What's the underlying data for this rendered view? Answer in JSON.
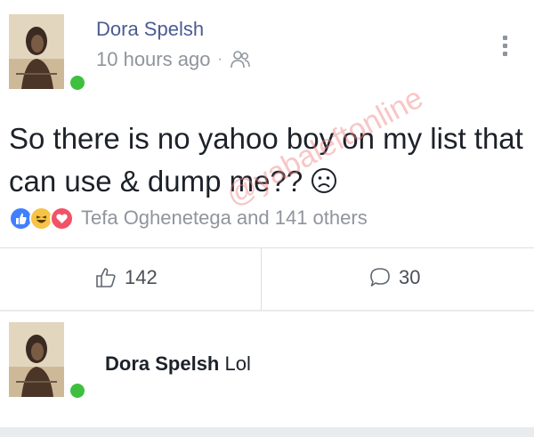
{
  "post": {
    "author": "Dora Spelsh",
    "time": "10 hours ago",
    "separator": "·",
    "audience_icon": "friends-icon",
    "text": "So there is no yahoo boy on my list that can use & dump me??",
    "text_emoji": "sad-face-icon",
    "reactions": {
      "icons": [
        "like-icon",
        "haha-icon",
        "love-icon"
      ],
      "text": "Tefa Oghenetega and 141 others"
    },
    "actions": {
      "like_count": "142",
      "comment_count": "30"
    }
  },
  "comment": {
    "author": "Dora Spelsh",
    "text": "Lol"
  },
  "colors": {
    "author_link": "#4b5c92",
    "online": "#3fbf3f",
    "like_blue": "#4080ff",
    "haha_yellow": "#f7c346",
    "love_red": "#f25268",
    "watermark": "#f08080"
  },
  "watermark": "@yabaleftonline"
}
